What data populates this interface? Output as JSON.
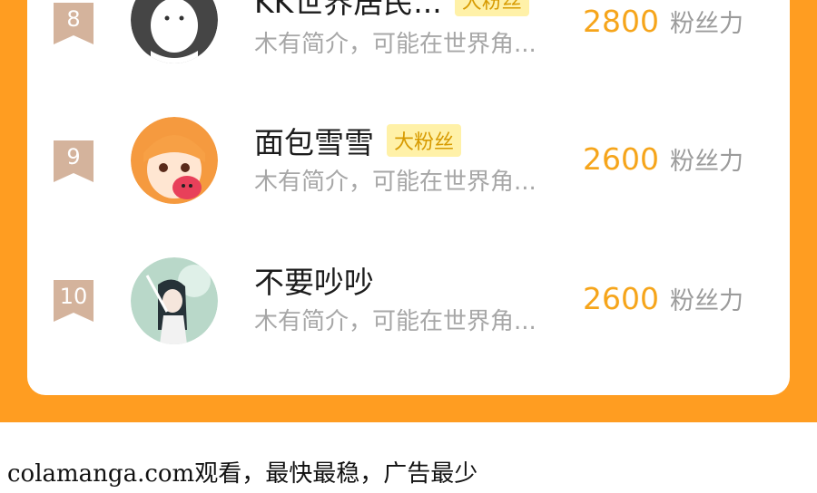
{
  "ranking": {
    "rows": [
      {
        "rank": "8",
        "name": "KK世界居民...",
        "badge": "大粉丝",
        "bio": "木有简介，可能在世界角...",
        "score": "2800",
        "score_unit": "粉丝力",
        "avatar": "ghost-mascot-avatar"
      },
      {
        "rank": "9",
        "name": "面包雪雪",
        "badge": "大粉丝",
        "bio": "木有简介，可能在世界角...",
        "score": "2600",
        "score_unit": "粉丝力",
        "avatar": "anime-girl-avatar"
      },
      {
        "rank": "10",
        "name": "不要吵吵",
        "badge": "",
        "bio": "木有简介，可能在世界角...",
        "score": "2600",
        "score_unit": "粉丝力",
        "avatar": "anime-girl-umbrella-avatar"
      }
    ]
  },
  "footer": {
    "text": "colamanga.com观看，最快最稳，广告最少"
  },
  "colors": {
    "orange": "#ff9d21",
    "badge_bg": "#fff1a8",
    "score": "#f6a51b"
  }
}
